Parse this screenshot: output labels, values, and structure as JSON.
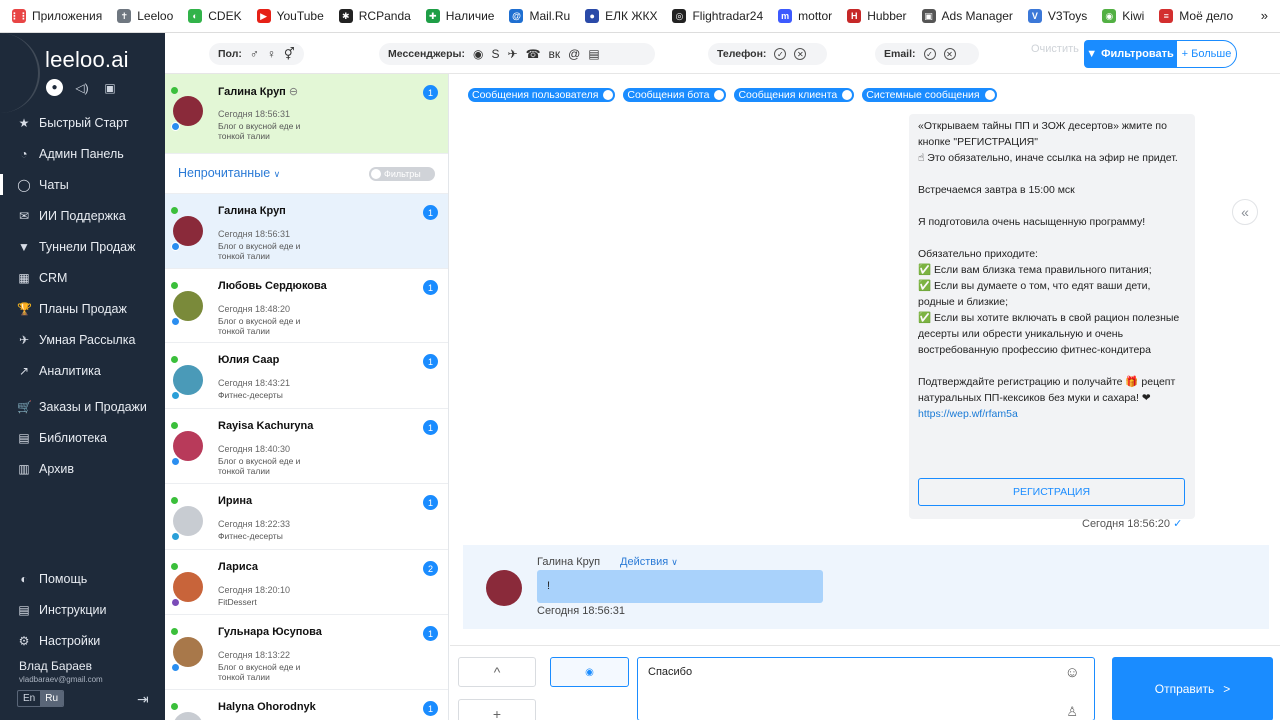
{
  "bookmarks": {
    "items": [
      {
        "label": "Приложения",
        "color": "#e84545",
        "glyph": "⋮⋮"
      },
      {
        "label": "Leeloo",
        "color": "#6f7780",
        "glyph": "✝"
      },
      {
        "label": "CDEK",
        "color": "#32b34a",
        "glyph": "◐"
      },
      {
        "label": "YouTube",
        "color": "#e62117",
        "glyph": "▶"
      },
      {
        "label": "RCPanda",
        "color": "#222222",
        "glyph": "✱"
      },
      {
        "label": "Наличие",
        "color": "#1e9e46",
        "glyph": "✚"
      },
      {
        "label": "Mail.Ru",
        "color": "#1f6fd1",
        "glyph": "@"
      },
      {
        "label": "ЕЛК ЖКХ",
        "color": "#2a4aa8",
        "glyph": "●"
      },
      {
        "label": "Flightradar24",
        "color": "#222222",
        "glyph": "◎"
      },
      {
        "label": "mottor",
        "color": "#3d5afe",
        "glyph": "m"
      },
      {
        "label": "Hubber",
        "color": "#c62828",
        "glyph": "H"
      },
      {
        "label": "Ads Manager",
        "color": "#555555",
        "glyph": "▣"
      },
      {
        "label": "V3Toys",
        "color": "#3b78d8",
        "glyph": "V"
      },
      {
        "label": "Kiwi",
        "color": "#52b043",
        "glyph": "◉"
      },
      {
        "label": "Моё дело",
        "color": "#d32f2f",
        "glyph": "≡"
      }
    ],
    "more": "»"
  },
  "sidebar": {
    "logo": "leeloo.ai",
    "top_icons": [
      "●",
      "◁)",
      "▣"
    ],
    "items": [
      {
        "label": "Быстрый Старт",
        "icon": "★"
      },
      {
        "label": "Админ Панель",
        "icon": "◔"
      },
      {
        "label": "Чаты",
        "icon": "◯"
      },
      {
        "label": "ИИ Поддержка",
        "icon": "✉"
      },
      {
        "label": "Туннели Продаж",
        "icon": "▼"
      },
      {
        "label": "CRM",
        "icon": "▦"
      },
      {
        "label": "Планы Продаж",
        "icon": "🏆"
      },
      {
        "label": "Умная Рассылка",
        "icon": "✈"
      },
      {
        "label": "Аналитика",
        "icon": "↗"
      },
      {
        "label": "Заказы и Продажи",
        "icon": "🛒"
      },
      {
        "label": "Библиотека",
        "icon": "▤"
      },
      {
        "label": "Архив",
        "icon": "▥"
      }
    ],
    "bottom_items": [
      {
        "label": "Помощь",
        "icon": "◐"
      },
      {
        "label": "Инструкции",
        "icon": "▤"
      },
      {
        "label": "Настройки",
        "icon": "⚙"
      }
    ],
    "user_name": "Влад Бараев",
    "user_email": "vladbaraev@gmail.com",
    "lang_en": "En",
    "lang_ru": "Ru",
    "exit_icon": "⇥"
  },
  "filters": {
    "gender_label": "Пол:",
    "gender_icons": [
      "♂",
      "♀",
      "⚥"
    ],
    "messengers_label": "Мессенджеры:",
    "messenger_icons": [
      "◉",
      "S",
      "✈",
      "☎",
      "вк",
      "@",
      "▤"
    ],
    "phone_label": "Телефон:",
    "email_label": "Email:",
    "check_icon": "✓",
    "x_icon": "✕",
    "clear": "Очистить",
    "filter_button": "Фильтровать",
    "more_button": "+ Больше"
  },
  "chatlist": {
    "pinned": {
      "name": "Галина Круп",
      "time": "Сегодня 18:56:31",
      "sub": "Блог о вкусной еде и тонкой талии",
      "badge": "1"
    },
    "unread_title": "Непрочитанные",
    "filters_toggle": "Фильтры",
    "rows": [
      {
        "name": "Галина Круп",
        "time": "Сегодня 18:56:31",
        "sub": "Блог о вкусной еде и тонкой талии",
        "badge": "1",
        "avatar": "#8a2a3a",
        "src": "#2a8ef0"
      },
      {
        "name": "Любовь Сердюкова",
        "time": "Сегодня 18:48:20",
        "sub": "Блог о вкусной еде и тонкой талии",
        "badge": "1",
        "avatar": "#7a8a3a",
        "src": "#2a8ef0"
      },
      {
        "name": "Юлия Саар",
        "time": "Сегодня 18:43:21",
        "sub": "Фитнес-десерты",
        "badge": "1",
        "avatar": "#4a9ab8",
        "src": "#2a9fd8"
      },
      {
        "name": "Rayisa Kachuryna",
        "time": "Сегодня 18:40:30",
        "sub": "Блог о вкусной еде и тонкой талии",
        "badge": "1",
        "avatar": "#b83a5a",
        "src": "#2a8ef0"
      },
      {
        "name": "Ирина",
        "time": "Сегодня 18:22:33",
        "sub": "Фитнес-десерты",
        "badge": "1",
        "avatar": "#c8ccd2",
        "src": "#2a9fd8"
      },
      {
        "name": "Лариса",
        "time": "Сегодня 18:20:10",
        "sub": "FitDessert",
        "badge": "2",
        "avatar": "#c8643a",
        "src": "#7b4bb8"
      },
      {
        "name": "Гульнара Юсупова",
        "time": "Сегодня 18:13:22",
        "sub": "Блог о вкусной еде и тонкой талии",
        "badge": "1",
        "avatar": "#a8784a",
        "src": "#2a8ef0"
      },
      {
        "name": "Halyna Ohorodnyk",
        "time": "",
        "sub": "",
        "badge": "1",
        "avatar": "#c8ccd2",
        "src": "#2a8ef0"
      }
    ]
  },
  "main": {
    "tags": [
      "Сообщения пользователя",
      "Сообщения бота",
      "Сообщения клиента",
      "Системные сообщения"
    ],
    "bot_message": "«Открываем тайны ПП и ЗОЖ десертов» жмите по кнопке \"РЕГИСТРАЦИЯ\"\n☝ Это обязательно, иначе ссылка на эфир не придет.\n\nВстречаемся завтра в 15:00 мск\n\nЯ подготовила очень насыщенную программу!\n\nОбязательно приходите:\n✅ Если вам близка тема правильного питания;\n✅ Если вы думаете о том, что едят ваши дети, родные и близкие;\n✅ Если вы хотите включать в свой рацион полезные десерты или обрести уникальную и очень востребованную профессию фитнес-кондитера\n\nПодтверждайте регистрацию и получайте 🎁 рецепт натуральных ПП-кексиков без муки и сахара! ❤",
    "bot_link": "https://wep.wf/rfam5a",
    "register_button": "РЕГИСТРАЦИЯ",
    "bot_time": "Сегодня 18:56:20",
    "collapse_icon": "«",
    "client_name": "Галина Круп",
    "client_actions": "Действия",
    "client_message": "!",
    "client_time": "Сегодня 18:56:31"
  },
  "composer": {
    "up_icon": "^",
    "plus_icon": "+",
    "eye_icon": "◉",
    "input_value": "Спасибо",
    "emoji_icon": "☺",
    "user_icon": "♙",
    "send_label": "Отправить",
    "send_icon": ">"
  }
}
